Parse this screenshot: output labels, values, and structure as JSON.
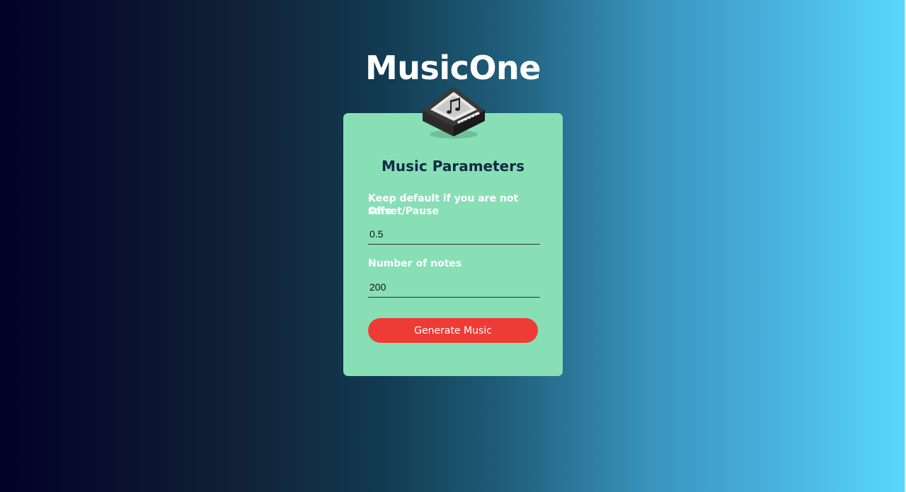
{
  "app": {
    "title": "MusicOne"
  },
  "card": {
    "icon": "music-keyboard-icon",
    "title": "Music Parameters",
    "hint": "Keep default if you are not sure",
    "fields": [
      {
        "label": "Offset/Pause",
        "value": "0.5"
      },
      {
        "label": "Number of notes",
        "value": "200"
      }
    ],
    "button_label": "Generate Music"
  },
  "colors": {
    "card_background": "#88dfb6",
    "button": "#ef3b36",
    "title_text": "#102a43",
    "gradient_start": "#000127",
    "gradient_end": "#5bd6ff"
  }
}
